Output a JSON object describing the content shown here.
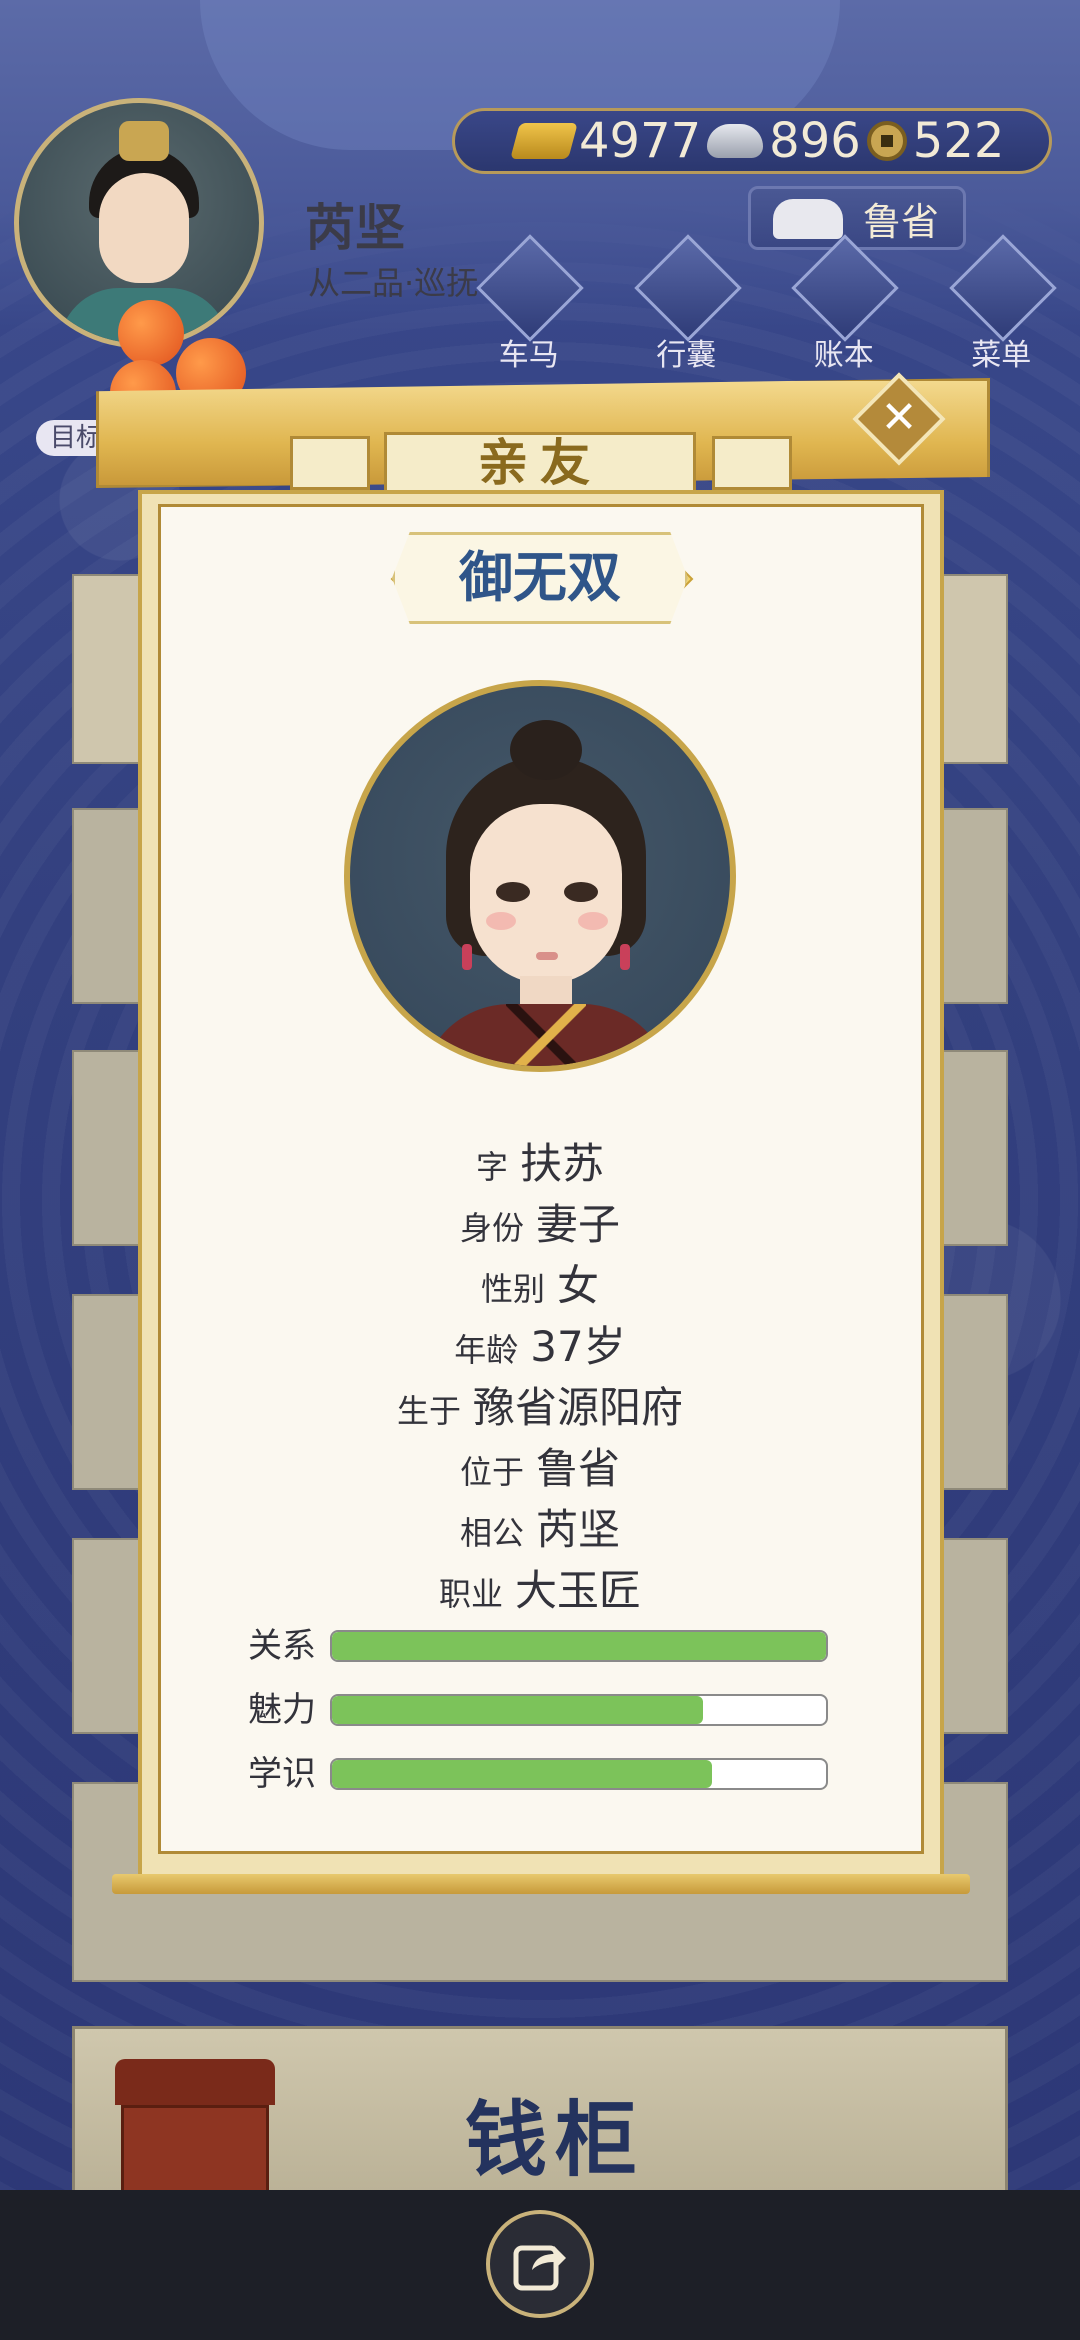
{
  "player": {
    "name": "芮坚",
    "rank": "从二品·巡抚"
  },
  "currency": {
    "gold": "4977",
    "silver": "896",
    "coins": "522"
  },
  "location": "鲁省",
  "nav": {
    "carriage": "车马",
    "bag": "行囊",
    "ledger": "账本",
    "menu": "菜单"
  },
  "goal_label": "目标",
  "modal": {
    "tab_title": "亲友",
    "person_name": "御无双",
    "fields": [
      {
        "key": "字",
        "value": "扶苏"
      },
      {
        "key": "身份",
        "value": "妻子"
      },
      {
        "key": "性别",
        "value": "女"
      },
      {
        "key": "年龄",
        "value": "37岁"
      },
      {
        "key": "生于",
        "value": "豫省源阳府"
      },
      {
        "key": "位于",
        "value": "鲁省"
      },
      {
        "key": "相公",
        "value": "芮坚"
      },
      {
        "key": "职业",
        "value": "大玉匠"
      }
    ],
    "bars": [
      {
        "label": "关系",
        "fraction": 1.0
      },
      {
        "label": "魅力",
        "fraction": 0.75
      },
      {
        "label": "学识",
        "fraction": 0.77
      }
    ]
  },
  "bottom_card_title": "钱柜",
  "icons": {
    "gold": "gold-ingot-icon",
    "silver": "silver-ingot-icon",
    "coin": "copper-coin-icon",
    "share": "share-icon",
    "close": "close-icon"
  },
  "colors": {
    "bar_fill": "#7cc35a",
    "name_blue": "#2f5589",
    "gold_trim": "#c7a54a"
  }
}
